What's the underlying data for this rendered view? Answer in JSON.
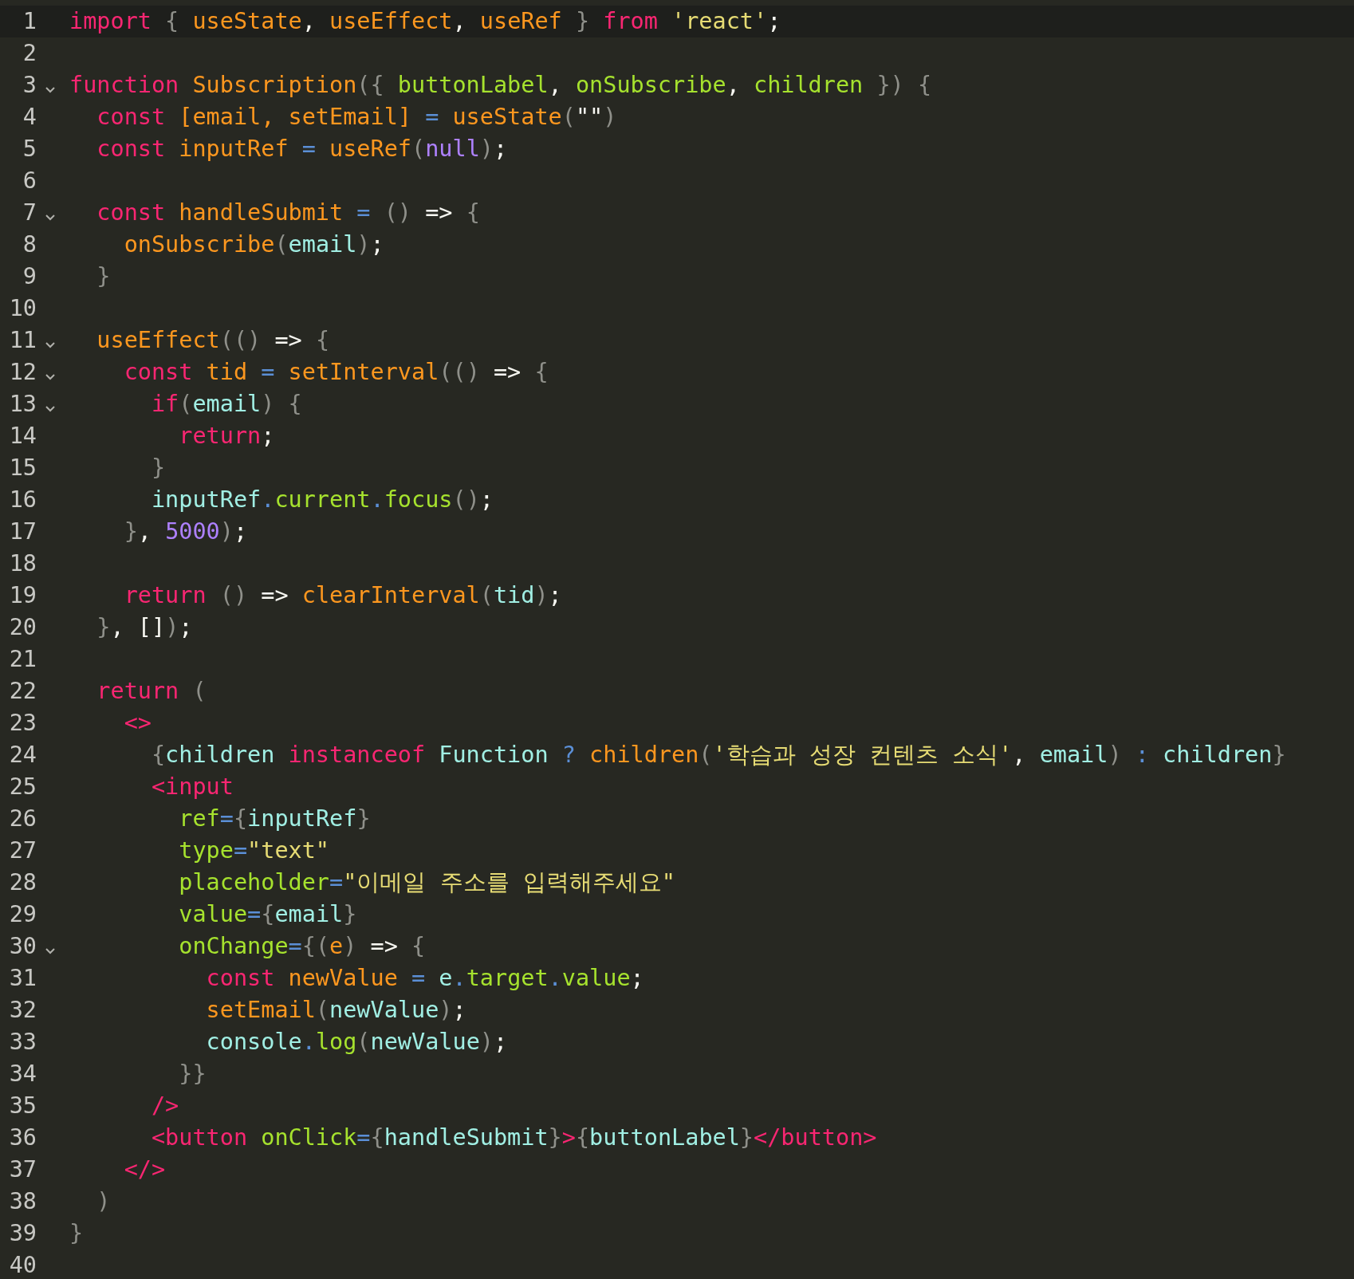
{
  "lines": [
    {
      "number": "1",
      "foldable": false,
      "current": true,
      "tokens": [
        {
          "kind": "keyword",
          "text": "import"
        },
        {
          "kind": "punct",
          "text": " { "
        },
        {
          "kind": "function",
          "text": "useState"
        },
        {
          "kind": "plain",
          "text": ", "
        },
        {
          "kind": "function",
          "text": "useEffect"
        },
        {
          "kind": "plain",
          "text": ", "
        },
        {
          "kind": "function",
          "text": "useRef"
        },
        {
          "kind": "punct",
          "text": " } "
        },
        {
          "kind": "keyword",
          "text": "from"
        },
        {
          "kind": "string",
          "text": " 'react'"
        },
        {
          "kind": "plain",
          "text": ";"
        }
      ]
    },
    {
      "number": "2",
      "foldable": false,
      "current": false
    },
    {
      "number": "3",
      "foldable": true,
      "current": false,
      "tokens": [
        {
          "kind": "keyword",
          "text": "function"
        },
        {
          "kind": "function",
          "text": " Subscription"
        },
        {
          "kind": "punct",
          "text": "({ "
        },
        {
          "kind": "attr",
          "text": "buttonLabel"
        },
        {
          "kind": "plain",
          "text": ", "
        },
        {
          "kind": "attr",
          "text": "onSubscribe"
        },
        {
          "kind": "plain",
          "text": ", "
        },
        {
          "kind": "attr",
          "text": "children"
        },
        {
          "kind": "punct",
          "text": " }) {"
        }
      ]
    },
    {
      "number": "4",
      "foldable": false,
      "current": false,
      "tokens": [
        {
          "kind": "keyword",
          "text": "  const"
        },
        {
          "kind": "function",
          "text": " [email, setEmail] "
        },
        {
          "kind": "operator",
          "text": "="
        },
        {
          "kind": "function",
          "text": " useState"
        },
        {
          "kind": "punct",
          "text": "("
        },
        {
          "kind": "plain",
          "text": "\"\""
        },
        {
          "kind": "punct",
          "text": ")"
        }
      ]
    },
    {
      "number": "5",
      "foldable": false,
      "current": false,
      "tokens": [
        {
          "kind": "keyword",
          "text": "  const"
        },
        {
          "kind": "function",
          "text": " inputRef "
        },
        {
          "kind": "operator",
          "text": "="
        },
        {
          "kind": "function",
          "text": " useRef"
        },
        {
          "kind": "punct",
          "text": "("
        },
        {
          "kind": "number",
          "text": "null"
        },
        {
          "kind": "punct",
          "text": ")"
        },
        {
          "kind": "plain",
          "text": ";"
        }
      ]
    },
    {
      "number": "6",
      "foldable": false,
      "current": false
    },
    {
      "number": "7",
      "foldable": true,
      "current": false,
      "tokens": [
        {
          "kind": "keyword",
          "text": "  const"
        },
        {
          "kind": "function",
          "text": " handleSubmit "
        },
        {
          "kind": "operator",
          "text": "="
        },
        {
          "kind": "punct",
          "text": " () "
        },
        {
          "kind": "plain",
          "text": "=>"
        },
        {
          "kind": "punct",
          "text": " {"
        }
      ]
    },
    {
      "number": "8",
      "foldable": false,
      "current": false,
      "tokens": [
        {
          "kind": "function",
          "text": "    onSubscribe"
        },
        {
          "kind": "punct",
          "text": "("
        },
        {
          "kind": "variable",
          "text": "email"
        },
        {
          "kind": "punct",
          "text": ")"
        },
        {
          "kind": "plain",
          "text": ";"
        }
      ]
    },
    {
      "number": "9",
      "foldable": false,
      "current": false,
      "tokens": [
        {
          "kind": "punct",
          "text": "  }"
        }
      ]
    },
    {
      "number": "10",
      "foldable": false,
      "current": false
    },
    {
      "number": "11",
      "foldable": true,
      "current": false,
      "tokens": [
        {
          "kind": "function",
          "text": "  useEffect"
        },
        {
          "kind": "punct",
          "text": "(() "
        },
        {
          "kind": "plain",
          "text": "=>"
        },
        {
          "kind": "punct",
          "text": " {"
        }
      ]
    },
    {
      "number": "12",
      "foldable": true,
      "current": false,
      "tokens": [
        {
          "kind": "keyword",
          "text": "    const"
        },
        {
          "kind": "function",
          "text": " tid "
        },
        {
          "kind": "operator",
          "text": "="
        },
        {
          "kind": "function",
          "text": " setInterval"
        },
        {
          "kind": "punct",
          "text": "(() "
        },
        {
          "kind": "plain",
          "text": "=>"
        },
        {
          "kind": "punct",
          "text": " {"
        }
      ]
    },
    {
      "number": "13",
      "foldable": true,
      "current": false,
      "tokens": [
        {
          "kind": "keyword",
          "text": "      if"
        },
        {
          "kind": "punct",
          "text": "("
        },
        {
          "kind": "variable",
          "text": "email"
        },
        {
          "kind": "punct",
          "text": ") {"
        }
      ]
    },
    {
      "number": "14",
      "foldable": false,
      "current": false,
      "tokens": [
        {
          "kind": "keyword",
          "text": "        return"
        },
        {
          "kind": "plain",
          "text": ";"
        }
      ]
    },
    {
      "number": "15",
      "foldable": false,
      "current": false,
      "tokens": [
        {
          "kind": "punct",
          "text": "      }"
        }
      ]
    },
    {
      "number": "16",
      "foldable": false,
      "current": false,
      "tokens": [
        {
          "kind": "variable",
          "text": "      inputRef"
        },
        {
          "kind": "operator",
          "text": "."
        },
        {
          "kind": "attr",
          "text": "current"
        },
        {
          "kind": "operator",
          "text": "."
        },
        {
          "kind": "attr",
          "text": "focus"
        },
        {
          "kind": "punct",
          "text": "()"
        },
        {
          "kind": "plain",
          "text": ";"
        }
      ]
    },
    {
      "number": "17",
      "foldable": false,
      "current": false,
      "tokens": [
        {
          "kind": "punct",
          "text": "    }"
        },
        {
          "kind": "plain",
          "text": ", "
        },
        {
          "kind": "number",
          "text": "5000"
        },
        {
          "kind": "punct",
          "text": ")"
        },
        {
          "kind": "plain",
          "text": ";"
        }
      ]
    },
    {
      "number": "18",
      "foldable": false,
      "current": false
    },
    {
      "number": "19",
      "foldable": false,
      "current": false,
      "tokens": [
        {
          "kind": "keyword",
          "text": "    return"
        },
        {
          "kind": "punct",
          "text": " () "
        },
        {
          "kind": "plain",
          "text": "=>"
        },
        {
          "kind": "function",
          "text": " clearInterval"
        },
        {
          "kind": "punct",
          "text": "("
        },
        {
          "kind": "variable",
          "text": "tid"
        },
        {
          "kind": "punct",
          "text": ")"
        },
        {
          "kind": "plain",
          "text": ";"
        }
      ]
    },
    {
      "number": "20",
      "foldable": false,
      "current": false,
      "tokens": [
        {
          "kind": "punct",
          "text": "  }"
        },
        {
          "kind": "plain",
          "text": ", []"
        },
        {
          "kind": "punct",
          "text": ")"
        },
        {
          "kind": "plain",
          "text": ";"
        }
      ]
    },
    {
      "number": "21",
      "foldable": false,
      "current": false
    },
    {
      "number": "22",
      "foldable": false,
      "current": false,
      "tokens": [
        {
          "kind": "keyword",
          "text": "  return"
        },
        {
          "kind": "punct",
          "text": " ("
        }
      ]
    },
    {
      "number": "23",
      "foldable": false,
      "current": false,
      "tokens": [
        {
          "kind": "keyword",
          "text": "    <>"
        }
      ]
    },
    {
      "number": "24",
      "foldable": false,
      "current": false,
      "tokens": [
        {
          "kind": "punct",
          "text": "      {"
        },
        {
          "kind": "variable",
          "text": "children"
        },
        {
          "kind": "keyword",
          "text": " instanceof"
        },
        {
          "kind": "variable",
          "text": " Function"
        },
        {
          "kind": "operator",
          "text": " ?"
        },
        {
          "kind": "function",
          "text": " children"
        },
        {
          "kind": "punct",
          "text": "("
        },
        {
          "kind": "string",
          "text": "'학습과 성장 컨텐츠 소식'"
        },
        {
          "kind": "plain",
          "text": ", "
        },
        {
          "kind": "variable",
          "text": "email"
        },
        {
          "kind": "punct",
          "text": ")"
        },
        {
          "kind": "operator",
          "text": " :"
        },
        {
          "kind": "variable",
          "text": " children"
        },
        {
          "kind": "punct",
          "text": "}"
        }
      ]
    },
    {
      "number": "25",
      "foldable": false,
      "current": false,
      "tokens": [
        {
          "kind": "keyword",
          "text": "      <input"
        }
      ]
    },
    {
      "number": "26",
      "foldable": false,
      "current": false,
      "tokens": [
        {
          "kind": "attr",
          "text": "        ref"
        },
        {
          "kind": "operator",
          "text": "="
        },
        {
          "kind": "punct",
          "text": "{"
        },
        {
          "kind": "variable",
          "text": "inputRef"
        },
        {
          "kind": "punct",
          "text": "}"
        }
      ]
    },
    {
      "number": "27",
      "foldable": false,
      "current": false,
      "tokens": [
        {
          "kind": "attr",
          "text": "        type"
        },
        {
          "kind": "operator",
          "text": "="
        },
        {
          "kind": "string",
          "text": "\"text\""
        }
      ]
    },
    {
      "number": "28",
      "foldable": false,
      "current": false,
      "tokens": [
        {
          "kind": "attr",
          "text": "        placeholder"
        },
        {
          "kind": "operator",
          "text": "="
        },
        {
          "kind": "string",
          "text": "\"이메일 주소를 입력해주세요\""
        }
      ]
    },
    {
      "number": "29",
      "foldable": false,
      "current": false,
      "tokens": [
        {
          "kind": "attr",
          "text": "        value"
        },
        {
          "kind": "operator",
          "text": "="
        },
        {
          "kind": "punct",
          "text": "{"
        },
        {
          "kind": "variable",
          "text": "email"
        },
        {
          "kind": "punct",
          "text": "}"
        }
      ]
    },
    {
      "number": "30",
      "foldable": true,
      "current": false,
      "tokens": [
        {
          "kind": "attr",
          "text": "        onChange"
        },
        {
          "kind": "operator",
          "text": "="
        },
        {
          "kind": "punct",
          "text": "{("
        },
        {
          "kind": "function",
          "text": "e"
        },
        {
          "kind": "punct",
          "text": ") "
        },
        {
          "kind": "plain",
          "text": "=>"
        },
        {
          "kind": "punct",
          "text": " {"
        }
      ]
    },
    {
      "number": "31",
      "foldable": false,
      "current": false,
      "tokens": [
        {
          "kind": "keyword",
          "text": "          const"
        },
        {
          "kind": "function",
          "text": " newValue "
        },
        {
          "kind": "operator",
          "text": "="
        },
        {
          "kind": "variable",
          "text": " e"
        },
        {
          "kind": "operator",
          "text": "."
        },
        {
          "kind": "attr",
          "text": "target"
        },
        {
          "kind": "operator",
          "text": "."
        },
        {
          "kind": "attr",
          "text": "value"
        },
        {
          "kind": "plain",
          "text": ";"
        }
      ]
    },
    {
      "number": "32",
      "foldable": false,
      "current": false,
      "tokens": [
        {
          "kind": "function",
          "text": "          setEmail"
        },
        {
          "kind": "punct",
          "text": "("
        },
        {
          "kind": "variable",
          "text": "newValue"
        },
        {
          "kind": "punct",
          "text": ")"
        },
        {
          "kind": "plain",
          "text": ";"
        }
      ]
    },
    {
      "number": "33",
      "foldable": false,
      "current": false,
      "tokens": [
        {
          "kind": "variable",
          "text": "          console"
        },
        {
          "kind": "operator",
          "text": "."
        },
        {
          "kind": "attr",
          "text": "log"
        },
        {
          "kind": "punct",
          "text": "("
        },
        {
          "kind": "variable",
          "text": "newValue"
        },
        {
          "kind": "punct",
          "text": ")"
        },
        {
          "kind": "plain",
          "text": ";"
        }
      ]
    },
    {
      "number": "34",
      "foldable": false,
      "current": false,
      "tokens": [
        {
          "kind": "punct",
          "text": "        }}"
        }
      ]
    },
    {
      "number": "35",
      "foldable": false,
      "current": false,
      "tokens": [
        {
          "kind": "keyword",
          "text": "      />"
        }
      ]
    },
    {
      "number": "36",
      "foldable": false,
      "current": false,
      "tokens": [
        {
          "kind": "keyword",
          "text": "      <button"
        },
        {
          "kind": "attr",
          "text": " onClick"
        },
        {
          "kind": "operator",
          "text": "="
        },
        {
          "kind": "punct",
          "text": "{"
        },
        {
          "kind": "variable",
          "text": "handleSubmit"
        },
        {
          "kind": "punct",
          "text": "}"
        },
        {
          "kind": "keyword",
          "text": ">"
        },
        {
          "kind": "punct",
          "text": "{"
        },
        {
          "kind": "variable",
          "text": "buttonLabel"
        },
        {
          "kind": "punct",
          "text": "}"
        },
        {
          "kind": "keyword",
          "text": "</button>"
        }
      ]
    },
    {
      "number": "37",
      "foldable": false,
      "current": false,
      "tokens": [
        {
          "kind": "keyword",
          "text": "    </>"
        }
      ]
    },
    {
      "number": "38",
      "foldable": false,
      "current": false,
      "tokens": [
        {
          "kind": "punct",
          "text": "  )"
        }
      ]
    },
    {
      "number": "39",
      "foldable": false,
      "current": false,
      "tokens": [
        {
          "kind": "punct",
          "text": "}"
        }
      ]
    },
    {
      "number": "40",
      "foldable": false,
      "current": false
    }
  ]
}
